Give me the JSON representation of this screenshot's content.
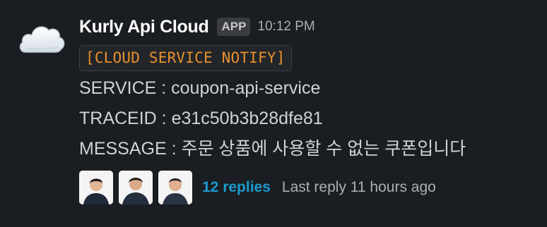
{
  "message": {
    "avatar_icon": "cloud-icon",
    "sender": "Kurly Api Cloud",
    "badge": "APP",
    "timestamp": "10:12 PM",
    "code": "[CLOUD SERVICE NOTIFY]",
    "lines": [
      "SERVICE : coupon-api-service",
      "TRACEID : e31c50b3b28dfe81",
      "MESSAGE : 주문 상품에 사용할 수 없는 쿠폰입니다"
    ]
  },
  "thread": {
    "participant_icons": [
      "participant-avatar-1",
      "participant-avatar-2",
      "participant-avatar-3"
    ],
    "replies_label": "12 replies",
    "last_reply": "Last reply 11 hours ago"
  },
  "colors": {
    "background": "#1a1d21",
    "code_text": "#e8912d",
    "link": "#1d9bd1"
  }
}
